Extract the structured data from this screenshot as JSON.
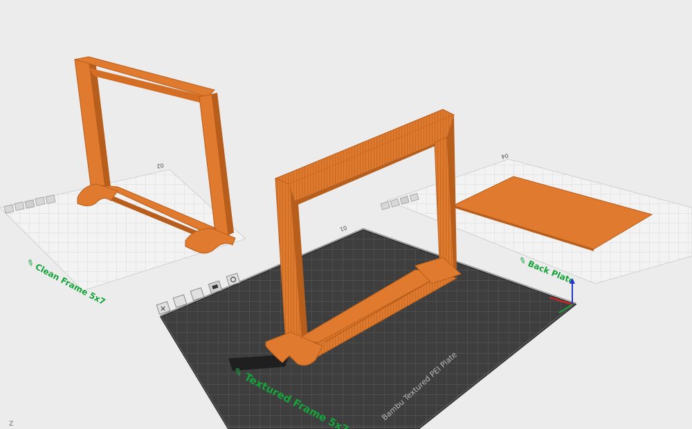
{
  "plates": [
    {
      "id": "plate-1",
      "number": "01",
      "name": "Textured Frame 5x7",
      "brand": "Bambu Textured PEI Plate",
      "active": true
    },
    {
      "id": "plate-2",
      "number": "02",
      "name": "Clean Frame 5x7",
      "active": false
    },
    {
      "id": "plate-3",
      "number": "04",
      "name": "Back Plate",
      "active": false
    }
  ],
  "axis_label": "Z",
  "colors": {
    "background": "#ececec",
    "model": "#e07a2e",
    "model_dark": "#b85e1c",
    "active_plate": "#3e3e3e",
    "inactive_plate": "#f2f2f2",
    "label": "#15a33a"
  },
  "icons": [
    "close-icon",
    "arrange-icon",
    "orient-icon",
    "lock-icon",
    "settings-icon"
  ]
}
